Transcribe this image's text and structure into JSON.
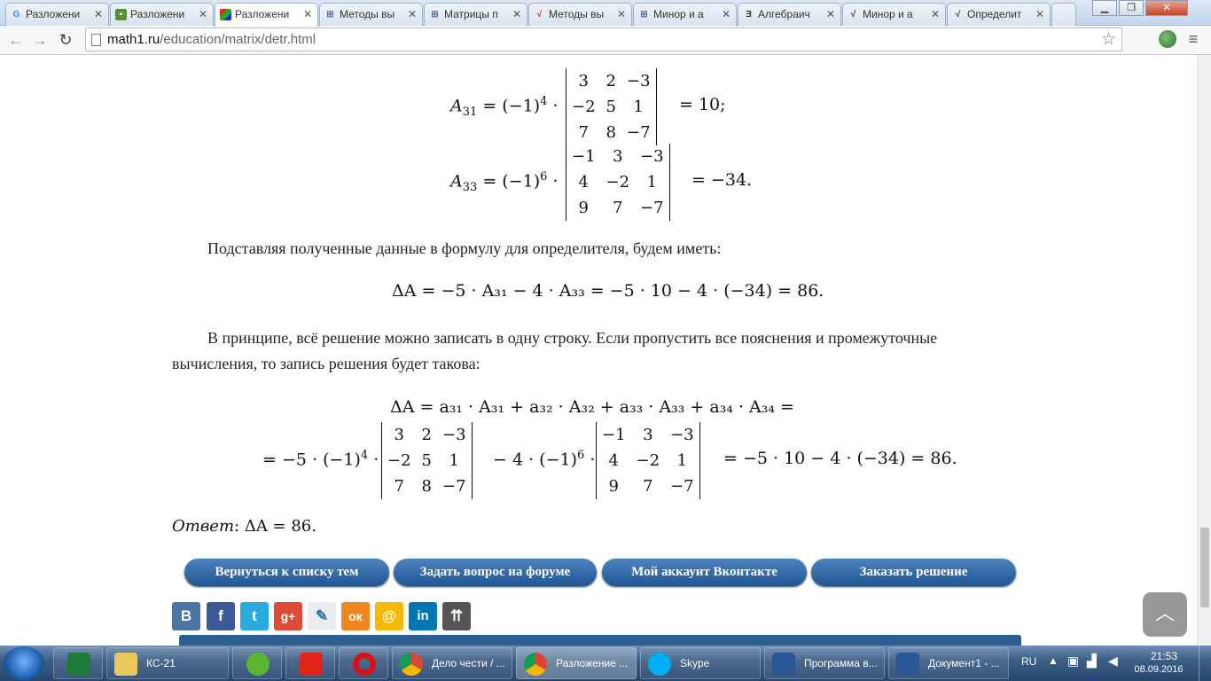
{
  "tabs": [
    {
      "label": "Разложени",
      "icon": "google-icon"
    },
    {
      "label": "Разложени",
      "icon": "puzzle-icon"
    },
    {
      "label": "Разложени",
      "icon": "colorful-icon"
    },
    {
      "label": "Методы вы",
      "icon": "grid-icon"
    },
    {
      "label": "Матрицы п",
      "icon": "grid-icon"
    },
    {
      "label": "Методы вы",
      "icon": "sqrt-x-icon"
    },
    {
      "label": "Минор и а",
      "icon": "grid-icon"
    },
    {
      "label": "Алгебраич",
      "icon": "e-icon"
    },
    {
      "label": "Минор и а",
      "icon": "sqrt-a-icon"
    },
    {
      "label": "Определит",
      "icon": "sqrt-a-icon"
    }
  ],
  "toolbar": {
    "url_host": "math1.ru",
    "url_path": "/education/matrix/detr.html"
  },
  "content": {
    "a31_lhs": "A",
    "a31_sub": "31",
    "a31_pow": "4",
    "a31_matrix": [
      [
        "3",
        "2",
        "−3"
      ],
      [
        "−2",
        "5",
        "1"
      ],
      [
        "7",
        "8",
        "−7"
      ]
    ],
    "a31_result": "= 10;",
    "a33_lhs": "A",
    "a33_sub": "33",
    "a33_pow": "6",
    "a33_matrix": [
      [
        "−1",
        "3",
        "−3"
      ],
      [
        "4",
        "−2",
        "1"
      ],
      [
        "9",
        "7",
        "−7"
      ]
    ],
    "a33_result": "= −34.",
    "para1": "Подставляя полученные данные в формулу для определителя, будем иметь:",
    "formula1": "ΔA = −5 · A₃₁ − 4 · A₃₃ = −5 · 10 − 4 · (−34) = 86.",
    "para2_line1": "В принципе, всё решение можно записать в одну строку. Если пропустить все пояснения и промежуточные",
    "para2_line2": "вычисления, то запись решения будет такова:",
    "formula2_line1": "ΔA = a₃₁ · A₃₁ + a₃₂ · A₃₂ + a₃₃ · A₃₃ + a₃₄ · A₃₄ =",
    "formula2_prefix": "= −5 · (−1)",
    "formula2_pow1": "4",
    "formula2_mid": "− 4 · (−1)",
    "formula2_pow2": "6",
    "formula2_result": "= −5 · 10 − 4 · (−34) = 86.",
    "answer_label": "Ответ",
    "answer_value": ": ΔA = 86."
  },
  "buttons": {
    "back": "Вернуться к списку тем",
    "forum": "Задать вопрос на форуме",
    "vk": "Мой аккаунт Вконтакте",
    "order": "Заказать решение"
  },
  "share_icons": [
    "В",
    "f",
    "t",
    "g+",
    "✎",
    "ок",
    "@",
    "in",
    "⇈"
  ],
  "taskbar": {
    "items": [
      {
        "label": "",
        "icon": "excel-icon"
      },
      {
        "label": "КС-21",
        "icon": "folder-icon"
      },
      {
        "label": "",
        "icon": "utorrent-icon"
      },
      {
        "label": "",
        "icon": "yandex-icon"
      },
      {
        "label": "",
        "icon": "opera-icon"
      },
      {
        "label": "Дело чести / ...",
        "icon": "chrome-icon"
      },
      {
        "label": "Разложение ...",
        "icon": "chrome-icon"
      },
      {
        "label": "Skype",
        "icon": "skype-icon"
      },
      {
        "label": "Программа в...",
        "icon": "word-icon"
      },
      {
        "label": "Документ1 - ...",
        "icon": "word-icon"
      }
    ],
    "lang": "RU",
    "time": "21:53",
    "date": "08.09.2016"
  },
  "colors": {
    "button_blue": "#2b64a3",
    "taskbar": "#3e5f86"
  }
}
